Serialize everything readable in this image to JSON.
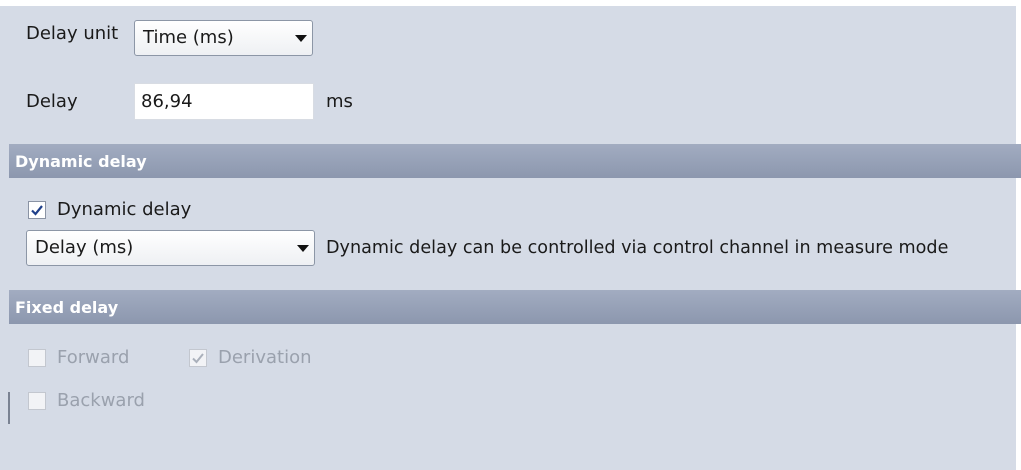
{
  "delay_unit": {
    "label": "Delay unit",
    "selected": "Time (ms)"
  },
  "delay": {
    "label": "Delay",
    "value": "86,94",
    "unit": "ms"
  },
  "dynamic_delay_section": {
    "header": "Dynamic delay",
    "checkbox_label": "Dynamic delay",
    "checked": true,
    "source_selected": "Delay (ms)",
    "info_text": "Dynamic delay can be controlled via control channel in measure mode"
  },
  "fixed_delay_section": {
    "header": "Fixed delay",
    "forward_label": "Forward",
    "forward_checked": false,
    "derivation_label": "Derivation",
    "derivation_checked": true,
    "backward_label": "Backward",
    "backward_checked": false
  },
  "colors": {
    "background": "#d5dbe6",
    "section_header": "#97a1b6",
    "disabled_text": "#9aa1ad",
    "check_mark": "#1f3f8a"
  }
}
